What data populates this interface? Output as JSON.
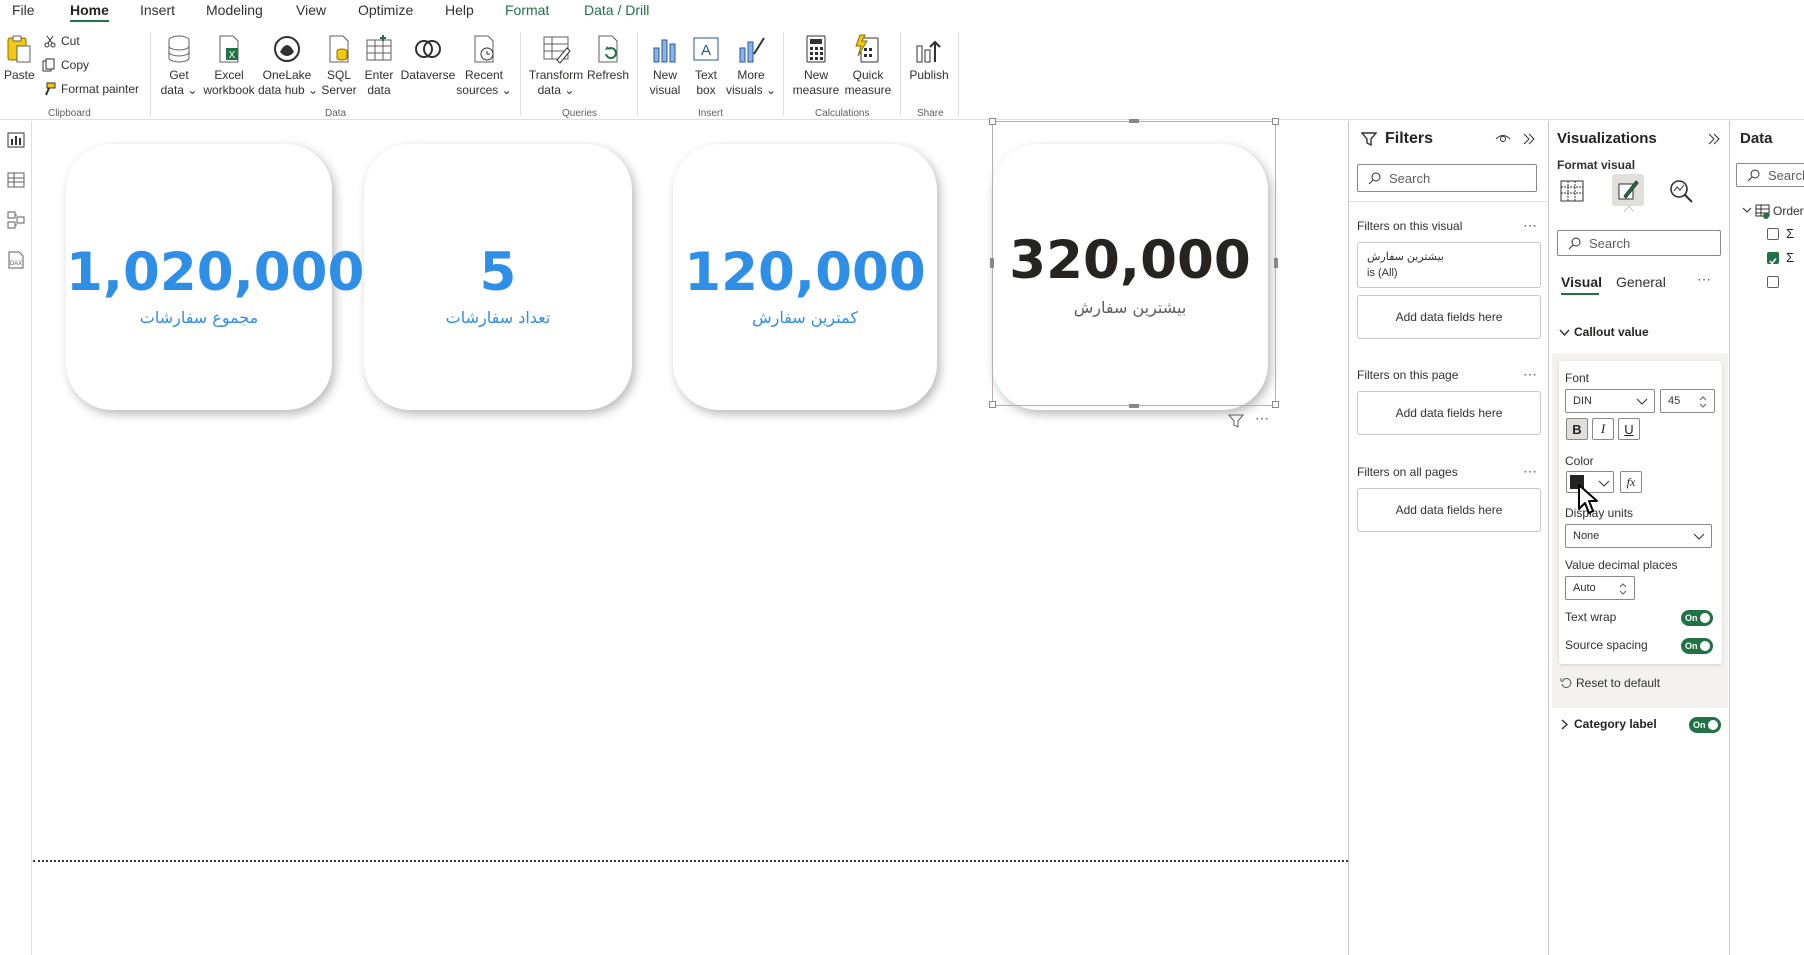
{
  "menu": {
    "tabs": [
      "File",
      "Home",
      "Insert",
      "Modeling",
      "View",
      "Optimize",
      "Help",
      "Format",
      "Data / Drill"
    ],
    "active": "Home"
  },
  "ribbon": {
    "clipboard": {
      "paste": "Paste",
      "cut": "Cut",
      "copy": "Copy",
      "format_painter": "Format painter",
      "group": "Clipboard"
    },
    "data": {
      "get_data": [
        "Get",
        "data"
      ],
      "excel": [
        "Excel",
        "workbook"
      ],
      "onelake": [
        "OneLake",
        "data hub"
      ],
      "sql": [
        "SQL",
        "Server"
      ],
      "enter": [
        "Enter",
        "data"
      ],
      "dataverse": "Dataverse",
      "recent": [
        "Recent",
        "sources"
      ],
      "group": "Data"
    },
    "queries": {
      "transform": [
        "Transform",
        "data"
      ],
      "refresh": "Refresh",
      "group": "Queries"
    },
    "insert": {
      "new_visual": [
        "New",
        "visual"
      ],
      "text_box": [
        "Text",
        "box"
      ],
      "more_visuals": [
        "More",
        "visuals"
      ],
      "group": "Insert"
    },
    "calculations": {
      "new_measure": [
        "New",
        "measure"
      ],
      "quick_measure": [
        "Quick",
        "measure"
      ],
      "group": "Calculations"
    },
    "share": {
      "publish": "Publish",
      "group": "Share"
    }
  },
  "cards": [
    {
      "value": "1,020,000",
      "label": "مجموع سفارشات"
    },
    {
      "value": "5",
      "label": "تعداد سفارشات"
    },
    {
      "value": "120,000",
      "label": "کمترین سفارش"
    },
    {
      "value": "320,000",
      "label": "بیشترین سفارش"
    }
  ],
  "filters": {
    "title": "Filters",
    "search_placeholder": "Search",
    "on_visual": "Filters on this visual",
    "visual_filter_field": "بیشترین سفارش",
    "visual_filter_state": "is (All)",
    "add_fields": "Add data fields here",
    "on_page": "Filters on this page",
    "on_all_pages": "Filters on all pages"
  },
  "visualizations": {
    "title": "Visualizations",
    "subtitle": "Format visual",
    "search_placeholder": "Search",
    "tab_visual": "Visual",
    "tab_general": "General",
    "section_callout": "Callout value",
    "font_label": "Font",
    "font_family": "DIN",
    "font_size": "45",
    "bold": "B",
    "italic": "I",
    "underline": "U",
    "color_label": "Color",
    "fx": "fx",
    "display_units_label": "Display units",
    "display_units_value": "None",
    "decimal_label": "Value decimal places",
    "decimal_value": "Auto",
    "text_wrap": "Text wrap",
    "source_spacing": "Source spacing",
    "toggle_on": "On",
    "reset": "Reset to default",
    "category_label": "Category label",
    "selected_color": "#252423"
  },
  "data_pane": {
    "title": "Data",
    "search_placeholder": "Search",
    "table": "Orders",
    "sigma": "Σ"
  },
  "theme": {
    "accent": "#217346",
    "card_blue": "#2f8fe6"
  }
}
